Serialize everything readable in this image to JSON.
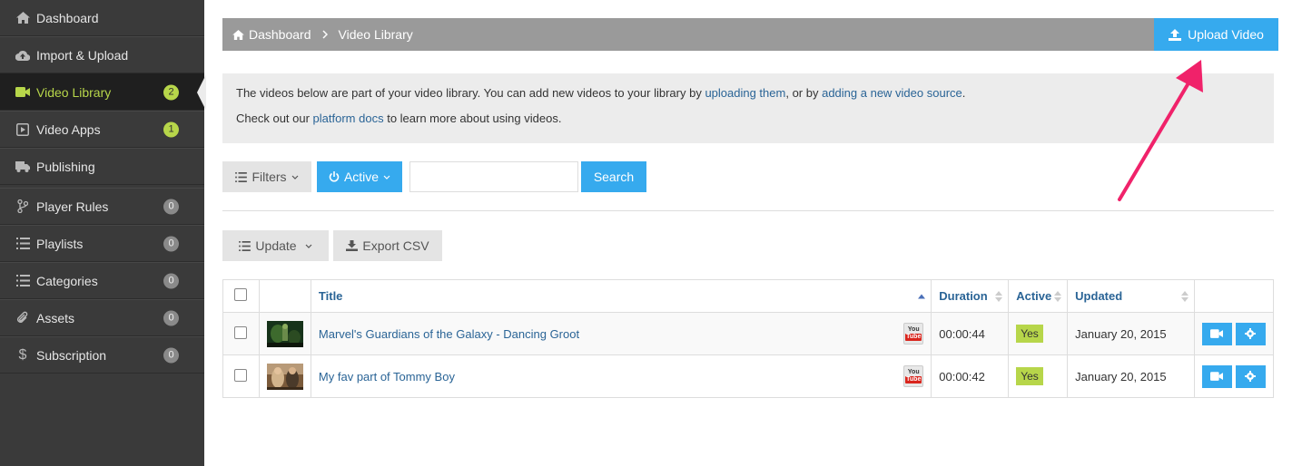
{
  "sidebar": {
    "items": [
      {
        "label": "Dashboard",
        "icon": "home-icon",
        "badge": null
      },
      {
        "label": "Import & Upload",
        "icon": "cloud-upload-icon",
        "badge": null
      },
      {
        "label": "Video Library",
        "icon": "video-camera-icon",
        "badge": "2"
      },
      {
        "label": "Video Apps",
        "icon": "play-square-icon",
        "badge": "1"
      },
      {
        "label": "Publishing",
        "icon": "truck-icon",
        "badge": null
      },
      {
        "label": "Player Rules",
        "icon": "branch-icon",
        "badge": "0"
      },
      {
        "label": "Playlists",
        "icon": "list-icon",
        "badge": "0"
      },
      {
        "label": "Categories",
        "icon": "list-icon",
        "badge": "0"
      },
      {
        "label": "Assets",
        "icon": "paperclip-icon",
        "badge": "0"
      },
      {
        "label": "Subscription",
        "icon": "dollar-icon",
        "badge": "0"
      }
    ]
  },
  "breadcrumb": {
    "home": "Dashboard",
    "current": "Video Library"
  },
  "upload_button": "Upload Video",
  "info": {
    "line1_pre": "The videos below are part of your video library. You can add new videos to your library by ",
    "line1_link1": "uploading them",
    "line1_mid": ", or by ",
    "line1_link2": "adding a new video source",
    "line1_post": ".",
    "line2_pre": "Check out our ",
    "line2_link": "platform docs",
    "line2_post": " to learn more about using videos."
  },
  "toolbar": {
    "filters_label": "Filters",
    "active_label": "Active",
    "search_value": "",
    "search_label": "Search",
    "update_label": "Update",
    "export_label": "Export CSV"
  },
  "table": {
    "headers": {
      "title": "Title",
      "duration": "Duration",
      "active": "Active",
      "updated": "Updated"
    },
    "rows": [
      {
        "title": "Marvel's Guardians of the Galaxy - Dancing Groot",
        "duration": "00:00:44",
        "active": "Yes",
        "updated": "January 20, 2015",
        "source": "You Tube"
      },
      {
        "title": "My fav part of Tommy Boy",
        "duration": "00:00:42",
        "active": "Yes",
        "updated": "January 20, 2015",
        "source": "You Tube"
      }
    ]
  },
  "colors": {
    "accent": "#36aaee",
    "sidebar_bg": "#3a3a3a",
    "active_green": "#b7d64a",
    "annotation_arrow": "#f0226a"
  }
}
